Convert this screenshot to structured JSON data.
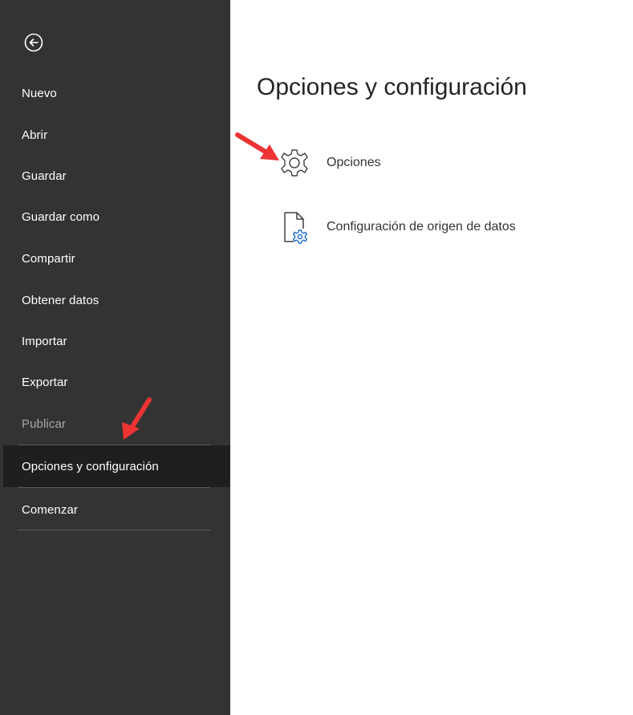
{
  "sidebar": {
    "back_icon": "back-arrow-circle-icon",
    "items": [
      {
        "label": "Nuevo"
      },
      {
        "label": "Abrir"
      },
      {
        "label": "Guardar"
      },
      {
        "label": "Guardar como"
      },
      {
        "label": "Compartir"
      },
      {
        "label": "Obtener datos"
      },
      {
        "label": "Importar"
      },
      {
        "label": "Exportar"
      },
      {
        "label": "Publicar",
        "state": "disabled"
      },
      {
        "label": "Opciones y configuración",
        "state": "selected"
      },
      {
        "label": "Comenzar"
      }
    ]
  },
  "main": {
    "title": "Opciones y configuración",
    "options": [
      {
        "label": "Opciones",
        "icon": "gear-icon"
      },
      {
        "label": "Configuración de origen de datos",
        "icon": "data-source-settings-icon"
      }
    ]
  },
  "annotations": {
    "arrow_color": "#ee3333"
  },
  "colors": {
    "sidebar_bg": "#333333",
    "selected_bg": "#1f1f1f",
    "accent_blue": "#1f6fc5"
  }
}
